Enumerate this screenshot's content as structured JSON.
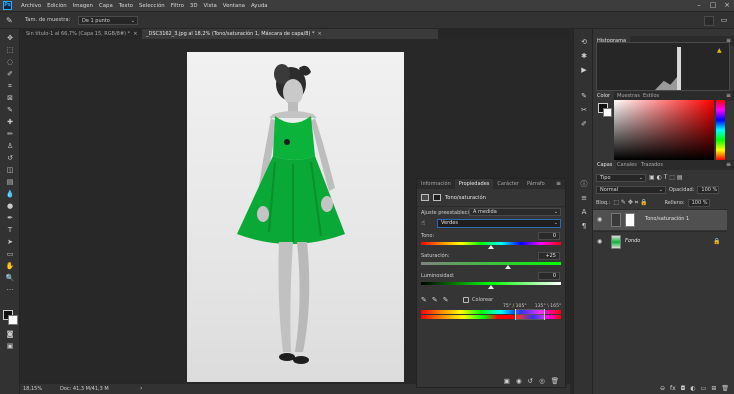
{
  "app": {
    "logo": "Ps"
  },
  "menubar": {
    "items": [
      "Archivo",
      "Edición",
      "Imagen",
      "Capa",
      "Texto",
      "Selección",
      "Filtro",
      "3D",
      "Vista",
      "Ventana",
      "Ayuda"
    ]
  },
  "window_controls": {
    "minimize": "–",
    "maximize": "□",
    "close": "×"
  },
  "options_bar": {
    "sample_size_label": "Tam. de muestra:",
    "sample_size_value": "De 1 punto"
  },
  "tabs": [
    {
      "label": "Sin título-1 al 66,7% (Capa 15, RGB/8#) *",
      "close": "×"
    },
    {
      "label": "_DSC3162_3.jpg al 18,2% (Tono/saturación 1, Máscara de capa/8) *",
      "close": "×"
    }
  ],
  "status_bar": {
    "zoom": "18,15%",
    "doc_size": "Doc: 41,3 M/41,3 M",
    "arrow": "›"
  },
  "properties_panel": {
    "tabs": [
      "Información",
      "Propiedades",
      "Carácter",
      "Párrafo"
    ],
    "title": "Tono/saturación",
    "preset_label": "Ajuste preestablecido:",
    "preset_value": "A medida",
    "channel_value": "Verdes",
    "hue_label": "Tono:",
    "hue_value": "0",
    "hue_pos": 0.5,
    "saturation_label": "Saturación:",
    "saturation_value": "+25",
    "saturation_pos": 0.62,
    "lightness_label": "Luminosidad:",
    "lightness_value": "0",
    "lightness_pos": 0.5,
    "colorize_label": "Colorear",
    "range_left": "75° / 105°",
    "range_right": "135° \\ 165°"
  },
  "histogram": {
    "tab": "Histograma",
    "warning": "▲"
  },
  "color_panel": {
    "tabs": [
      "Color",
      "Muestras",
      "Estilos"
    ],
    "fg": "#111111",
    "bg": "#ffffff"
  },
  "layers_panel": {
    "tabs": [
      "Capas",
      "Canales",
      "Trazados"
    ],
    "filter_value": "Tipo",
    "blend_mode": "Normal",
    "opacity_label": "Opacidad:",
    "opacity_value": "100 %",
    "lock_label": "Bloq.:",
    "fill_label": "Relleno:",
    "fill_value": "100 %",
    "layers": [
      {
        "name": "Tono/saturación 1",
        "selected": true
      },
      {
        "name": "Fondo",
        "selected": false
      }
    ]
  },
  "colors": {
    "accent": "#2c6bb4",
    "dress_green": "#0bb33a"
  }
}
